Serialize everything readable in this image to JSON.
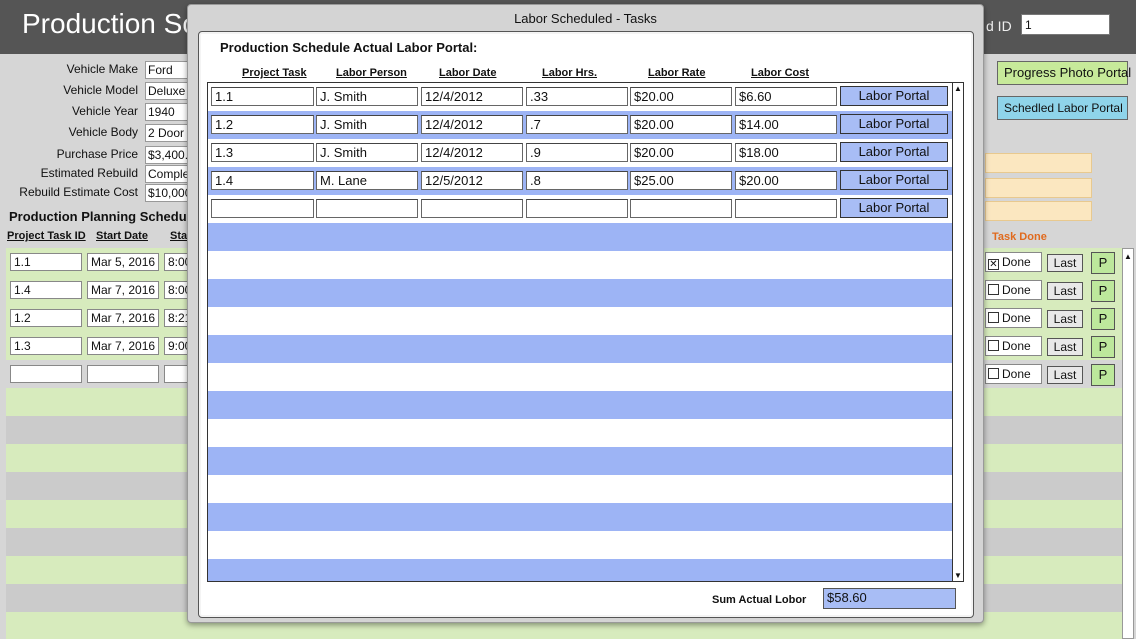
{
  "background": {
    "title": "Production Sc",
    "record_id_label": "d ID",
    "record_id_value": "1",
    "vehicle_fields": [
      {
        "label": "Vehicle Make",
        "value": "Ford"
      },
      {
        "label": "Vehicle Model",
        "value": "Deluxe"
      },
      {
        "label": "Vehicle Year",
        "value": "1940"
      },
      {
        "label": "Vehicle Body",
        "value": "2 Door"
      },
      {
        "label": "Purchase Price",
        "value": "$3,400."
      },
      {
        "label": "Estimated Rebuild",
        "value": "Comple"
      },
      {
        "label": "Rebuild Estimate Cost",
        "value": "$10,000"
      }
    ],
    "planning_title": "Production Planning Schedu",
    "planning_headers": {
      "task_id": "Project Task ID",
      "start_date": "Start Date",
      "start": "Sta"
    },
    "planning_rows": [
      {
        "task_id": "1.1",
        "start_date": "Mar 5, 2016",
        "time": "8:00",
        "done": true
      },
      {
        "task_id": "1.4",
        "start_date": "Mar 7, 2016",
        "time": "8:00",
        "done": false
      },
      {
        "task_id": "1.2",
        "start_date": "Mar 7, 2016",
        "time": "8:21",
        "done": false
      },
      {
        "task_id": "1.3",
        "start_date": "Mar 7, 2016",
        "time": "9:00",
        "done": false
      },
      {
        "task_id": "",
        "start_date": "",
        "time": "",
        "done": false
      }
    ],
    "progress_photo_portal": "Progress Photo Portal",
    "scheduled_labor_portal": "Schedled Labor Portal",
    "task_done_header": "Task Done",
    "done_label": "Done",
    "last_label": "Last",
    "p_label": "P",
    "done_check_glyph": "✕"
  },
  "modal": {
    "window_title": "Labor Scheduled - Tasks",
    "portal_title": "Production Schedule Actual Labor Portal:",
    "columns": {
      "task": "Project Task",
      "person": "Labor Person",
      "date": "Labor Date",
      "hours": "Labor Hrs.",
      "rate": "Labor Rate",
      "cost": "Labor Cost"
    },
    "button_label": "Labor Portal",
    "rows": [
      {
        "task": "1.1",
        "person": "J. Smith",
        "date": "12/4/2012",
        "hours": ".33",
        "rate": "$20.00",
        "cost": "$6.60"
      },
      {
        "task": "1.2",
        "person": "J. Smith",
        "date": "12/4/2012",
        "hours": ".7",
        "rate": "$20.00",
        "cost": "$14.00"
      },
      {
        "task": "1.3",
        "person": "J. Smith",
        "date": "12/4/2012",
        "hours": ".9",
        "rate": "$20.00",
        "cost": "$18.00"
      },
      {
        "task": "1.4",
        "person": "M. Lane",
        "date": "12/5/2012",
        "hours": ".8",
        "rate": "$25.00",
        "cost": "$20.00"
      },
      {
        "task": "",
        "person": "",
        "date": "",
        "hours": "",
        "rate": "",
        "cost": ""
      }
    ],
    "sum_label": "Sum Actual Lobor",
    "sum_value": "$58.60"
  },
  "colors": {
    "row_blue": "#9db4f5",
    "button_blue": "#a8bdf5",
    "progress_green": "#c7ea9a",
    "scheduled_cyan": "#8fd4ea",
    "task_done_orange": "#e06a1e"
  }
}
